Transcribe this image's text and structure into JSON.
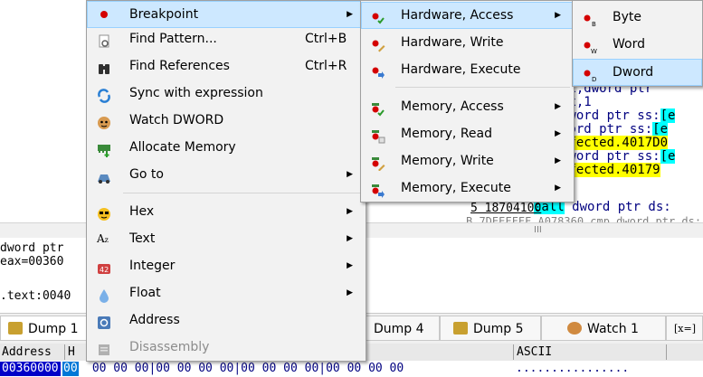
{
  "disasm": {
    "lines": [
      {
        "pre": "cx,dword ptr ",
        "hl": "",
        "post": "",
        "hlcls": ""
      },
      {
        "pre": "cx,1",
        "hl": "",
        "post": "",
        "hlcls": ""
      },
      {
        "pre": "dword ptr ss:",
        "hl": "[e",
        "post": "",
        "hlcls": "cyan"
      },
      {
        "pre": "word ptr ss:",
        "hl": "[e",
        "post": "",
        "hlcls": "cyan"
      },
      {
        "pre": "",
        "hl": "nfected.4017D0",
        "post": "",
        "hlcls": "yellow"
      },
      {
        "pre": "dword ptr ss:",
        "hl": "[e",
        "post": "",
        "hlcls": "cyan"
      },
      {
        "pre": "",
        "hl": "nfected.40179",
        "post": "",
        "hlcls": "yellow"
      },
      {
        "pre": "0",
        "hl": "",
        "post": "",
        "hlcls": ""
      }
    ],
    "call_row_call": "call",
    "call_row_rest": " dword ptr ds:",
    "addr_row": "5 18704100",
    "addr_row_2": "B 7DEEFFFF A078360 cmp dword ptr ds:",
    "scroll_grip": "III"
  },
  "info": {
    "lines": [
      "dword ptr",
      "eax=00360",
      "",
      ".text:0040"
    ]
  },
  "tabs": [
    {
      "label": "Dump 1",
      "icon": "dump-icon",
      "color": "#c8a030"
    },
    {
      "label": "Dump 4",
      "icon": "dump-icon",
      "color": "#c8a030"
    },
    {
      "label": "Dump 5",
      "icon": "dump-icon",
      "color": "#c8a030"
    },
    {
      "label": "Watch 1",
      "icon": "watch-icon",
      "color": "#d08a40"
    },
    {
      "label": "[x=]",
      "icon": "",
      "color": ""
    }
  ],
  "dump": {
    "header_address": "Address",
    "header_hex": "H",
    "header_ascii": "ASCII",
    "row_address": "00360000",
    "row_first_byte": "00",
    "row_rest": " 00 00 00|00 00 00 00|00 00 00 00|00 00 00 00",
    "row_ascii": "................"
  },
  "main_menu": {
    "items": [
      {
        "label": "Breakpoint",
        "shortcut": "",
        "submenu": true,
        "icon": "breakpoint-icon",
        "disabled": false
      },
      {
        "label": "Find Pattern...",
        "shortcut": "Ctrl+B",
        "submenu": false,
        "icon": "find-pattern-icon",
        "disabled": false
      },
      {
        "label": "Find References",
        "shortcut": "Ctrl+R",
        "submenu": false,
        "icon": "binoculars-icon",
        "disabled": false
      },
      {
        "label": "Sync with expression",
        "shortcut": "",
        "submenu": false,
        "icon": "sync-icon",
        "disabled": false
      },
      {
        "label": "Watch DWORD",
        "shortcut": "",
        "submenu": false,
        "icon": "watch-icon",
        "disabled": false
      },
      {
        "label": "Allocate Memory",
        "shortcut": "",
        "submenu": false,
        "icon": "memory-icon",
        "disabled": false
      },
      {
        "label": "Go to",
        "shortcut": "",
        "submenu": true,
        "icon": "goto-icon",
        "disabled": false
      },
      {
        "label": "Hex",
        "shortcut": "",
        "submenu": true,
        "icon": "hex-icon",
        "disabled": false
      },
      {
        "label": "Text",
        "shortcut": "",
        "submenu": true,
        "icon": "text-icon",
        "disabled": false
      },
      {
        "label": "Integer",
        "shortcut": "",
        "submenu": true,
        "icon": "integer-icon",
        "disabled": false
      },
      {
        "label": "Float",
        "shortcut": "",
        "submenu": true,
        "icon": "float-icon",
        "disabled": false
      },
      {
        "label": "Address",
        "shortcut": "",
        "submenu": false,
        "icon": "address-icon",
        "disabled": false
      },
      {
        "label": "Disassembly",
        "shortcut": "",
        "submenu": false,
        "icon": "disassembly-icon",
        "disabled": true
      }
    ]
  },
  "bp_menu": {
    "items": [
      {
        "label": "Hardware, Access",
        "submenu": true
      },
      {
        "label": "Hardware, Write",
        "submenu": false
      },
      {
        "label": "Hardware, Execute",
        "submenu": false
      },
      {
        "label": "Memory, Access",
        "submenu": true
      },
      {
        "label": "Memory, Read",
        "submenu": true
      },
      {
        "label": "Memory, Write",
        "submenu": true
      },
      {
        "label": "Memory, Execute",
        "submenu": true
      }
    ]
  },
  "hw_menu": {
    "items": [
      {
        "label": "Byte",
        "sub": "B"
      },
      {
        "label": "Word",
        "sub": "W"
      },
      {
        "label": "Dword",
        "sub": "D"
      }
    ]
  },
  "colors": {
    "menu_bg": "#f2f2f2",
    "hover": "#cde8ff",
    "breakpoint_red": "#d40000",
    "highlight_yellow": "#ffff00",
    "highlight_cyan": "#00ffff"
  }
}
